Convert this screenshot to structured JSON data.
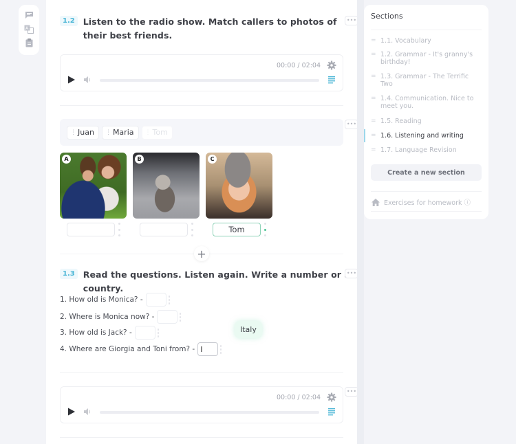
{
  "toolbar": {
    "icons": [
      "comment-icon",
      "translate-icon",
      "clipboard-icon"
    ]
  },
  "tasks": {
    "t12": {
      "number": "1.2",
      "title": "Listen to the radio show. Match callers to photos of their best friends."
    },
    "t13": {
      "number": "1.3",
      "title": "Read the questions. Listen again. Write a number or a country."
    }
  },
  "audio": [
    {
      "time": "00:00 / 02:04",
      "progress": 0
    },
    {
      "time": "00:00 / 02:04",
      "progress": 0
    }
  ],
  "more_label": "•••",
  "word_bank": [
    {
      "label": "Juan",
      "used": false
    },
    {
      "label": "Maria",
      "used": false
    },
    {
      "label": "Tom",
      "used": true
    }
  ],
  "photos": [
    {
      "badge": "A",
      "description": "boy and girl hugging outdoors",
      "answer": ""
    },
    {
      "badge": "B",
      "description": "hairless dog on a leash",
      "answer": ""
    },
    {
      "badge": "C",
      "description": "girl with glasses and grey hat",
      "answer": "Tom"
    }
  ],
  "add_label": "+",
  "questions": [
    {
      "text": "1. How old is Monica? -",
      "answer": ""
    },
    {
      "text": "2. Where is Monica now? -",
      "answer": ""
    },
    {
      "text": "3. How old is Jack? -",
      "answer": ""
    },
    {
      "text": "4. Where are Giorgia and Toni from? -",
      "answer": ""
    }
  ],
  "dragging_chip": "Italy",
  "sections": {
    "title": "Sections",
    "items": [
      {
        "label": "1.1. Vocabulary",
        "active": false
      },
      {
        "label": "1.2. Grammar - It's granny's birthday!",
        "active": false
      },
      {
        "label": "1.3. Grammar - The Terrific Two",
        "active": false
      },
      {
        "label": "1.4. Communication. Nice to meet you.",
        "active": false
      },
      {
        "label": "1.5. Reading",
        "active": false
      },
      {
        "label": "1.6. Listening and writing",
        "active": true
      },
      {
        "label": "1.7. Language Revision",
        "active": false
      }
    ],
    "create_button": "Create a new section",
    "homework": "Exercises for homework ⓘ"
  },
  "colors": {
    "accent": "#4bb6d6",
    "success": "#4fc596",
    "text": "#3f4148",
    "muted": "#b9bcc4"
  }
}
